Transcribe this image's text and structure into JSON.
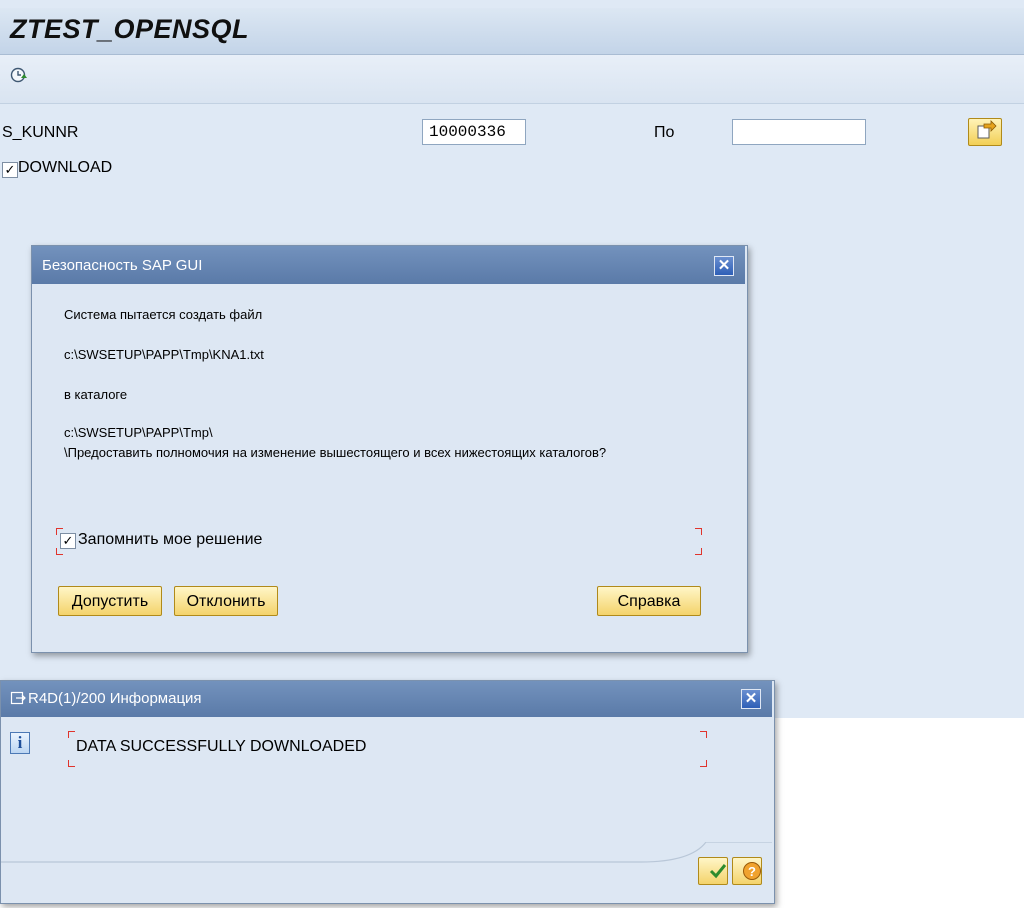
{
  "screen": {
    "title": "ZTEST_OPENSQL",
    "toolbar": {
      "execute_icon": "execute-clock-icon"
    },
    "fields": {
      "skunnr_label": "S_KUNNR",
      "skunnr_from": "10000336",
      "to_label": "По",
      "skunnr_to": "",
      "download_label": "DOWNLOAD",
      "download_checked": true
    }
  },
  "security_dialog": {
    "title": "Безопасность SAP GUI",
    "line1": "Система пытается создать файл",
    "line2": "c:\\SWSETUP\\PAPP\\Tmp\\KNA1.txt",
    "line3": "в каталоге",
    "line4": "c:\\SWSETUP\\PAPP\\Tmp\\",
    "line5": "\\Предоставить полномочия на изменение вышестоящего и всех нижестоящих каталогов?",
    "remember_label": "Запомнить мое решение",
    "remember_checked": true,
    "allow_button": "Допустить",
    "deny_button": "Отклонить",
    "help_button": "Справка"
  },
  "info_dialog": {
    "title": "R4D(1)/200 Информация",
    "message": "DATA SUCCESSFULLY DOWNLOADED"
  },
  "colors": {
    "title_bar": "#c3d4e8",
    "dialog_title": "#5a7aa8",
    "button": "#f4d36b",
    "accent_red": "#e0342c"
  }
}
